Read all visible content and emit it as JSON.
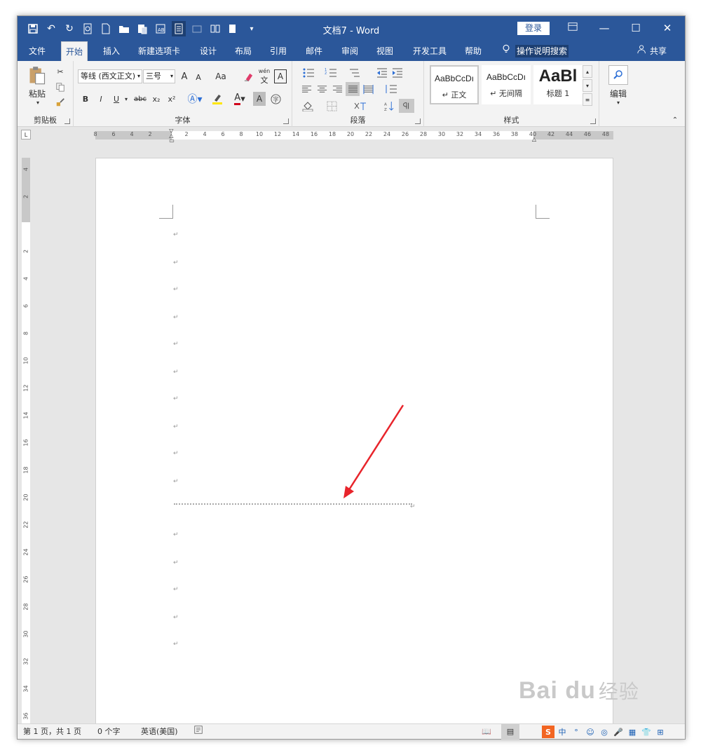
{
  "titlebar": {
    "title": "文档7  -  Word",
    "login": "登录",
    "ribbon_display_icon": "ribbon-display-icon",
    "minimize": "—",
    "restore": "☐",
    "close": "✕"
  },
  "tabs": [
    "文件",
    "开始",
    "插入",
    "新建选项卡",
    "设计",
    "布局",
    "引用",
    "邮件",
    "审阅",
    "视图",
    "开发工具",
    "帮助"
  ],
  "tell_me": "操作说明搜索",
  "share": "共享",
  "clipboard": {
    "paste": "粘贴",
    "label": "剪贴板"
  },
  "font": {
    "name": "等线 (西文正文)",
    "size": "三号",
    "grow": "A",
    "shrink": "A",
    "case": "Aa",
    "bold": "B",
    "italic": "I",
    "underline": "U",
    "strike": "abc",
    "sub": "x₂",
    "sup": "x²",
    "label": "字体",
    "phonetic": "wén"
  },
  "paragraph": {
    "label": "段落"
  },
  "styles": {
    "items": [
      {
        "preview": "AaBbCcDı",
        "name": "↵ 正文"
      },
      {
        "preview": "AaBbCcDı",
        "name": "↵ 无间隔"
      },
      {
        "preview": "AaBl",
        "name": "标题 1"
      }
    ],
    "label": "样式"
  },
  "editing": {
    "label": "编辑"
  },
  "hruler": [
    "8",
    "6",
    "4",
    "2",
    "",
    "2",
    "4",
    "6",
    "8",
    "10",
    "12",
    "14",
    "16",
    "18",
    "20",
    "22",
    "24",
    "26",
    "28",
    "30",
    "32",
    "34",
    "36",
    "38",
    "40",
    "42",
    "44",
    "46",
    "48"
  ],
  "vruler": [
    "4",
    "2",
    "",
    "2",
    "4",
    "6",
    "8",
    "10",
    "12",
    "14",
    "16",
    "18",
    "20",
    "22",
    "24",
    "26",
    "28",
    "30",
    "32",
    "34",
    "36"
  ],
  "para_mark": "↵",
  "status": {
    "page": "第 1 页，共 1 页",
    "words": "0 个字",
    "lang": "英语(美国)"
  },
  "watermark": {
    "text": "Bai du",
    "cn": "经验"
  },
  "ime": [
    "S",
    "中",
    "°",
    "☺",
    "◎",
    "🎤",
    "▦",
    "👕",
    "⊞"
  ]
}
